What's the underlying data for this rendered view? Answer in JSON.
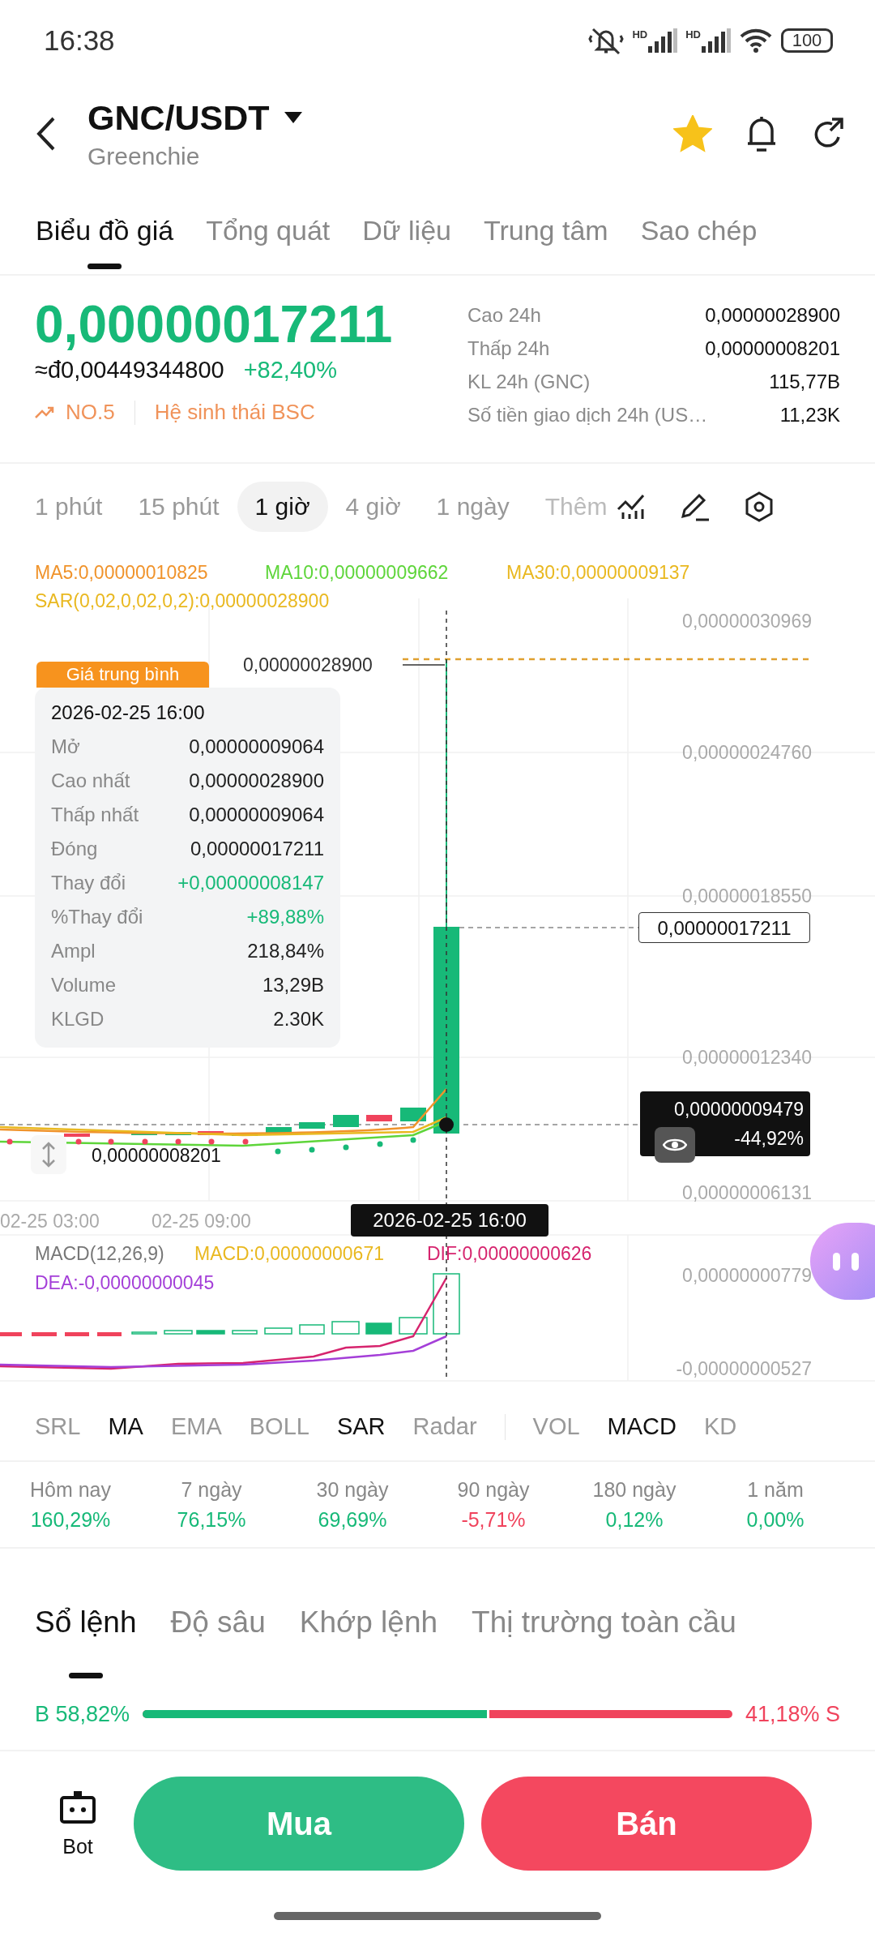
{
  "status_bar": {
    "time": "16:38",
    "signals": [
      {
        "label": "HD"
      },
      {
        "label": "HD"
      }
    ],
    "battery": "100"
  },
  "header": {
    "pair": "GNC/USDT",
    "name": "Greenchie",
    "favorite": true
  },
  "tabs": [
    {
      "label": "Biểu đồ giá",
      "selected": true
    },
    {
      "label": "Tổng quát",
      "selected": false
    },
    {
      "label": "Dữ liệu",
      "selected": false
    },
    {
      "label": "Trung tâm",
      "selected": false
    },
    {
      "label": "Sao chép",
      "selected": false
    }
  ],
  "ticker": {
    "price": "0,00000017211",
    "fiat": "≈đ0,00449344800",
    "change": "+82,40%",
    "rank": "NO.5",
    "tag": "Hệ sinh thái BSC",
    "stats": [
      {
        "label": "Cao 24h",
        "value": "0,00000028900"
      },
      {
        "label": "Thấp 24h",
        "value": "0,00000008201"
      },
      {
        "label": "KL 24h (GNC)",
        "value": "115,77B"
      },
      {
        "label": "Số tiền giao dịch 24h (US…",
        "value": "11,23K"
      }
    ]
  },
  "intervals": [
    {
      "label": "1 phút",
      "selected": false
    },
    {
      "label": "15 phút",
      "selected": false
    },
    {
      "label": "1 giờ",
      "selected": true
    },
    {
      "label": "4 giờ",
      "selected": false
    },
    {
      "label": "1 ngày",
      "selected": false
    },
    {
      "label": "Thêm",
      "selected": false
    }
  ],
  "chart": {
    "legend": [
      {
        "text": "MA5:0,00000010825",
        "color": "#f0932b"
      },
      {
        "text": "MA10:0,00000009662",
        "color": "#5ed53a"
      },
      {
        "text": "MA30:0,00000009137",
        "color": "#e9b820"
      }
    ],
    "sar": {
      "text": "SAR(0,02,0,02,0,2):0,00000028900",
      "color": "#e9b820"
    },
    "avg_tag": "Giá trung bình",
    "tooltip": {
      "time": "2026-02-25 16:00",
      "rows": [
        {
          "label": "Mở",
          "value": "0,00000009064",
          "kind": "plain"
        },
        {
          "label": "Cao nhất",
          "value": "0,00000028900",
          "kind": "plain"
        },
        {
          "label": "Thấp nhất",
          "value": "0,00000009064",
          "kind": "plain"
        },
        {
          "label": "Đóng",
          "value": "0,00000017211",
          "kind": "plain"
        },
        {
          "label": "Thay đổi",
          "value": "+0,00000008147",
          "kind": "up"
        },
        {
          "label": "%Thay đổi",
          "value": "+89,88%",
          "kind": "up"
        },
        {
          "label": "Ampl",
          "value": "218,84%",
          "kind": "plain"
        },
        {
          "label": "Volume",
          "value": "13,29B",
          "kind": "plain"
        },
        {
          "label": "KLGD",
          "value": "2.30K",
          "kind": "plain"
        }
      ]
    },
    "y_labels": [
      "0,00000030969",
      "0,00000024760",
      "0,00000018550",
      "0,00000012340",
      "0,00000006131"
    ],
    "high_label": "0,00000028900",
    "low_label": "0,00000008201",
    "close_tag": "0,00000017211",
    "last_price": "0,00000009479",
    "last_change": "-44,92%",
    "x_labels": [
      "02-25 03:00",
      "02-25 09:00"
    ],
    "cursor_time": "2026-02-25 16:00"
  },
  "macd": {
    "legend": [
      {
        "text": "MACD(12,26,9)",
        "color": "#777777"
      },
      {
        "text": "MACD:0,00000000671",
        "color": "#e9b820"
      },
      {
        "text": "DIF:0,00000000626",
        "color": "#d6246e"
      },
      {
        "text": "DEA:-0,00000000045",
        "color": "#a43fd8"
      }
    ],
    "y_labels": [
      "0,00000000779",
      "-0,00000000527"
    ]
  },
  "indicators_main": [
    {
      "label": "SRL",
      "selected": false
    },
    {
      "label": "MA",
      "selected": true
    },
    {
      "label": "EMA",
      "selected": false
    },
    {
      "label": "BOLL",
      "selected": false
    },
    {
      "label": "SAR",
      "selected": true
    },
    {
      "label": "Radar",
      "selected": false
    }
  ],
  "indicators_sub": [
    {
      "label": "VOL",
      "selected": false
    },
    {
      "label": "MACD",
      "selected": true
    },
    {
      "label": "KD",
      "selected": false
    }
  ],
  "performance": [
    {
      "period": "Hôm nay",
      "value": "160,29%",
      "kind": "up"
    },
    {
      "period": "7 ngày",
      "value": "76,15%",
      "kind": "up"
    },
    {
      "period": "30 ngày",
      "value": "69,69%",
      "kind": "up"
    },
    {
      "period": "90 ngày",
      "value": "-5,71%",
      "kind": "down"
    },
    {
      "period": "180 ngày",
      "value": "0,12%",
      "kind": "up"
    },
    {
      "period": "1 năm",
      "value": "0,00%",
      "kind": "up"
    }
  ],
  "book_tabs": [
    {
      "label": "Sổ lệnh",
      "selected": true
    },
    {
      "label": "Độ sâu",
      "selected": false
    },
    {
      "label": "Khớp lệnh",
      "selected": false
    },
    {
      "label": "Thị trường toàn cầu",
      "selected": false
    }
  ],
  "ratio": {
    "buy": "B 58,82%",
    "sell": "41,18% S",
    "level": 0.5882
  },
  "actions": {
    "bot": "Bot",
    "buy": "Mua",
    "sell": "Bán"
  }
}
